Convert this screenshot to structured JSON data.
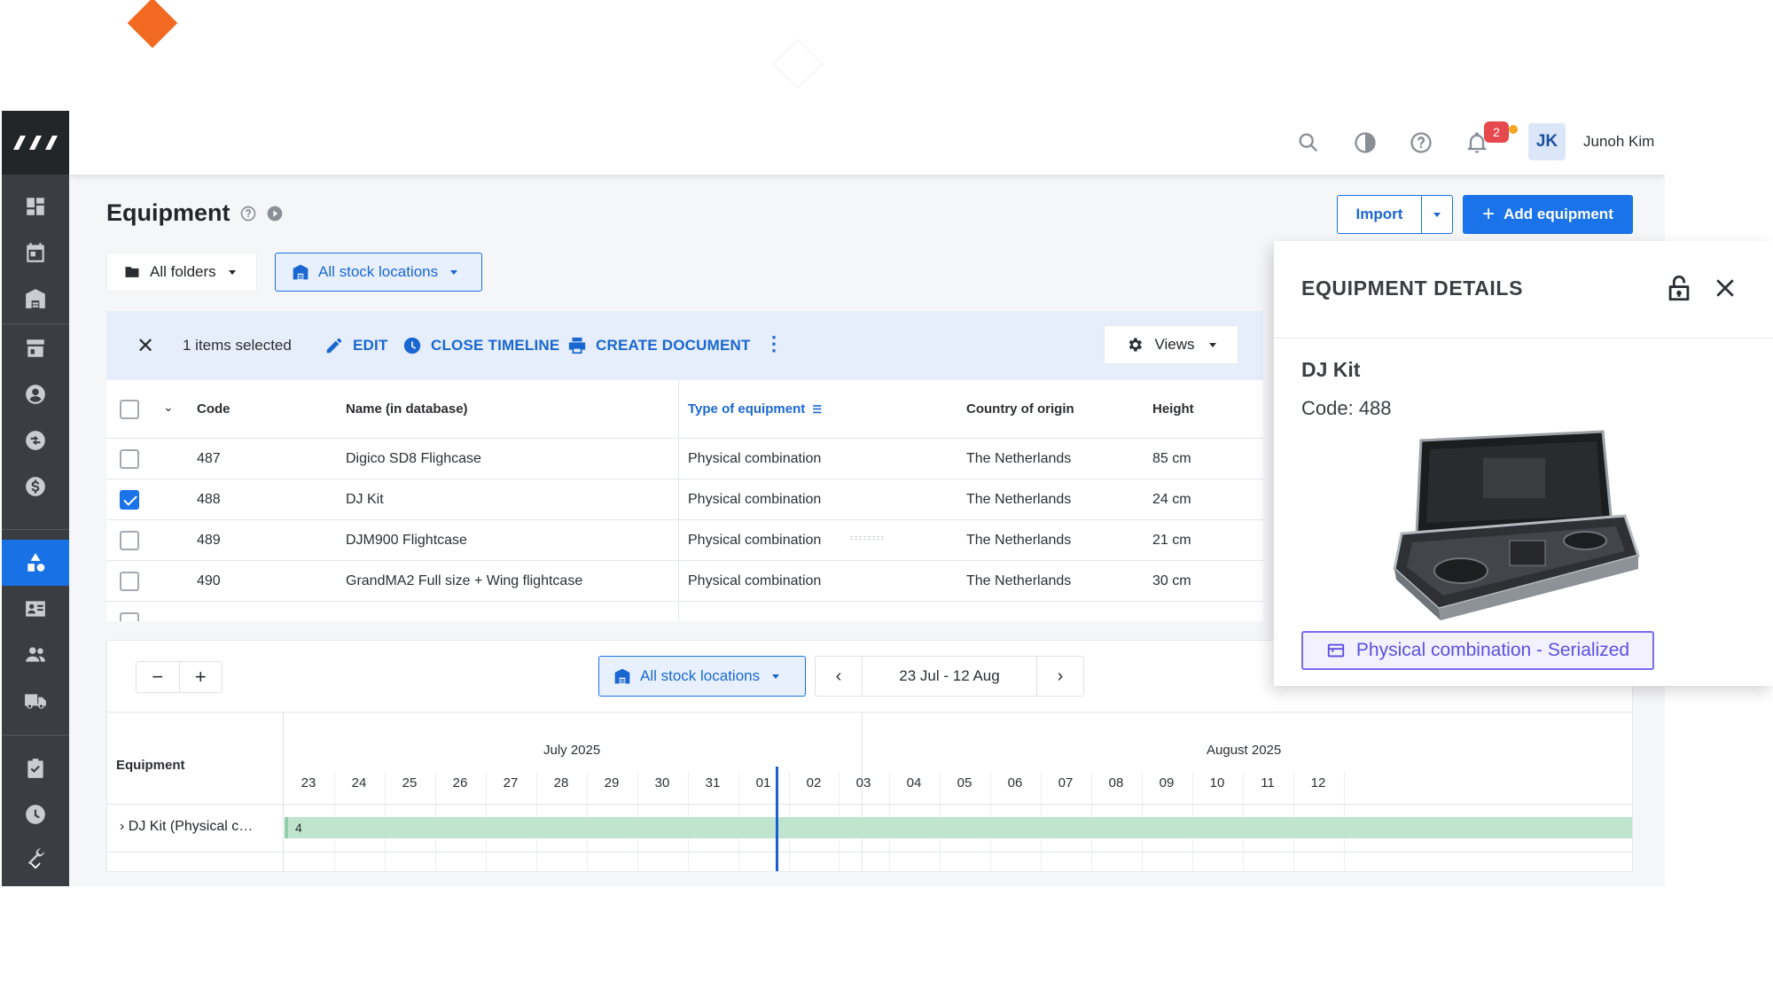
{
  "topbar": {
    "user_initials": "JK",
    "user_name": "Junoh Kim",
    "notification_count": "2"
  },
  "page": {
    "title": "Equipment"
  },
  "buttons": {
    "import": "Import",
    "add_equipment": "Add equipment"
  },
  "filters": {
    "folders": "All folders",
    "stock_locations": "All stock locations"
  },
  "actionbar": {
    "selected": "1 items selected",
    "edit": "EDIT",
    "close_timeline": "CLOSE TIMELINE",
    "create_document": "CREATE DOCUMENT",
    "views": "Views"
  },
  "table": {
    "columns": [
      "Code",
      "Name (in database)",
      "Type of equipment",
      "Country of origin",
      "Height"
    ],
    "rows": [
      {
        "code": "487",
        "name": "Digico SD8 Flighcase",
        "type": "Physical combination",
        "country": "The Netherlands",
        "height": "85 cm",
        "checked": false
      },
      {
        "code": "488",
        "name": "DJ Kit",
        "type": "Physical combination",
        "country": "The Netherlands",
        "height": "24 cm",
        "checked": true
      },
      {
        "code": "489",
        "name": "DJM900 Flightcase",
        "type": "Physical combination",
        "country": "The Netherlands",
        "height": "21 cm",
        "checked": false
      },
      {
        "code": "490",
        "name": "GrandMA2 Full size + Wing flightcase",
        "type": "Physical combination",
        "country": "The Netherlands",
        "height": "30 cm",
        "checked": false
      }
    ]
  },
  "timeline": {
    "zoom_out": "−",
    "zoom_in": "+",
    "location": "All stock locations",
    "range": "23 Jul - 12 Aug",
    "header": "Equipment",
    "months": [
      "July 2025",
      "August 2025"
    ],
    "days": [
      "23",
      "24",
      "25",
      "26",
      "27",
      "28",
      "29",
      "30",
      "31",
      "01",
      "02",
      "03",
      "04",
      "05",
      "06",
      "07",
      "08",
      "09",
      "10",
      "11",
      "12"
    ],
    "row_label": "DJ Kit (Physical c…",
    "bar_label": "4"
  },
  "details": {
    "title": "EQUIPMENT DETAILS",
    "name": "DJ Kit",
    "code": "Code: 488",
    "type": "Physical combination - Serialized"
  },
  "colors": {
    "accent": "#1a73e8",
    "sidebar": "#3a3d41",
    "badge": "#7b6df2",
    "bar": "#bfe5cf",
    "logo": "#f26a21"
  }
}
